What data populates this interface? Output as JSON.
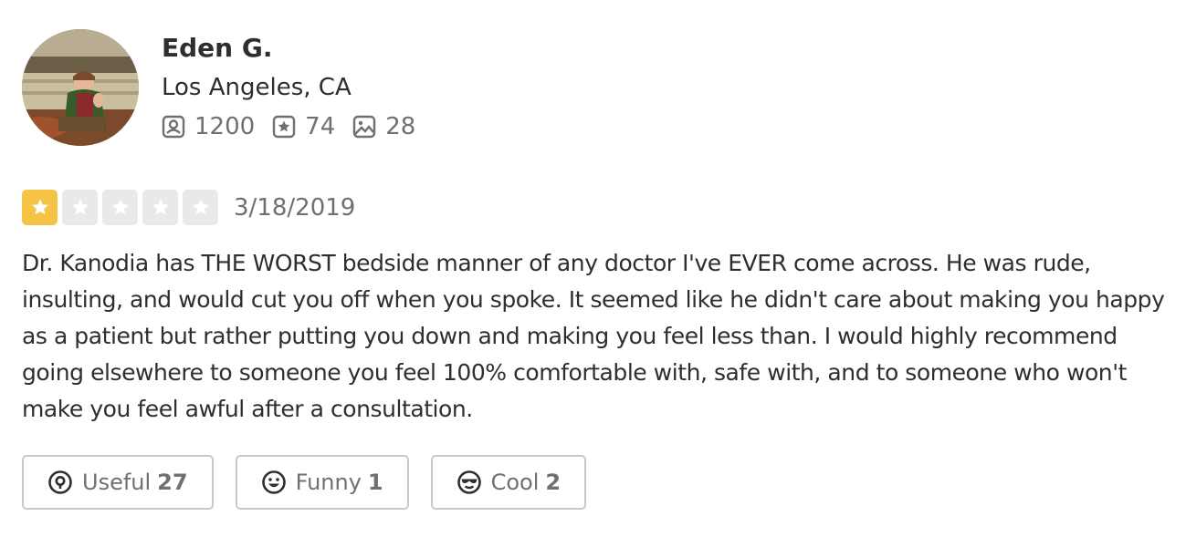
{
  "user": {
    "name": "Eden G.",
    "location": "Los Angeles, CA",
    "stats": {
      "friends": "1200",
      "reviews": "74",
      "photos": "28"
    }
  },
  "review": {
    "rating": 1,
    "max_rating": 5,
    "date": "3/18/2019",
    "text": "Dr. Kanodia has THE WORST bedside manner of any doctor I've EVER come across. He was rude, insulting, and would cut you off when you spoke. It seemed like he didn't care about making you happy as a patient but rather putting you down and making you feel less than. I would highly recommend going elsewhere to someone you feel 100% comfortable with, safe with, and to someone who won't make you feel awful after a consultation."
  },
  "reactions": {
    "useful": {
      "label": "Useful",
      "count": "27"
    },
    "funny": {
      "label": "Funny",
      "count": "1"
    },
    "cool": {
      "label": "Cool",
      "count": "2"
    }
  },
  "colors": {
    "star_filled": "#f5c445",
    "star_empty": "#e9e9ea",
    "text_primary": "#2d2e2f",
    "text_secondary": "#6e7072",
    "border": "#c8c9ca"
  },
  "icons": {
    "friends": "friends-icon",
    "reviews": "reviews-star-icon",
    "photos": "photos-icon",
    "useful": "useful-lightbulb-icon",
    "funny": "funny-smiley-icon",
    "cool": "cool-sunglasses-icon"
  }
}
